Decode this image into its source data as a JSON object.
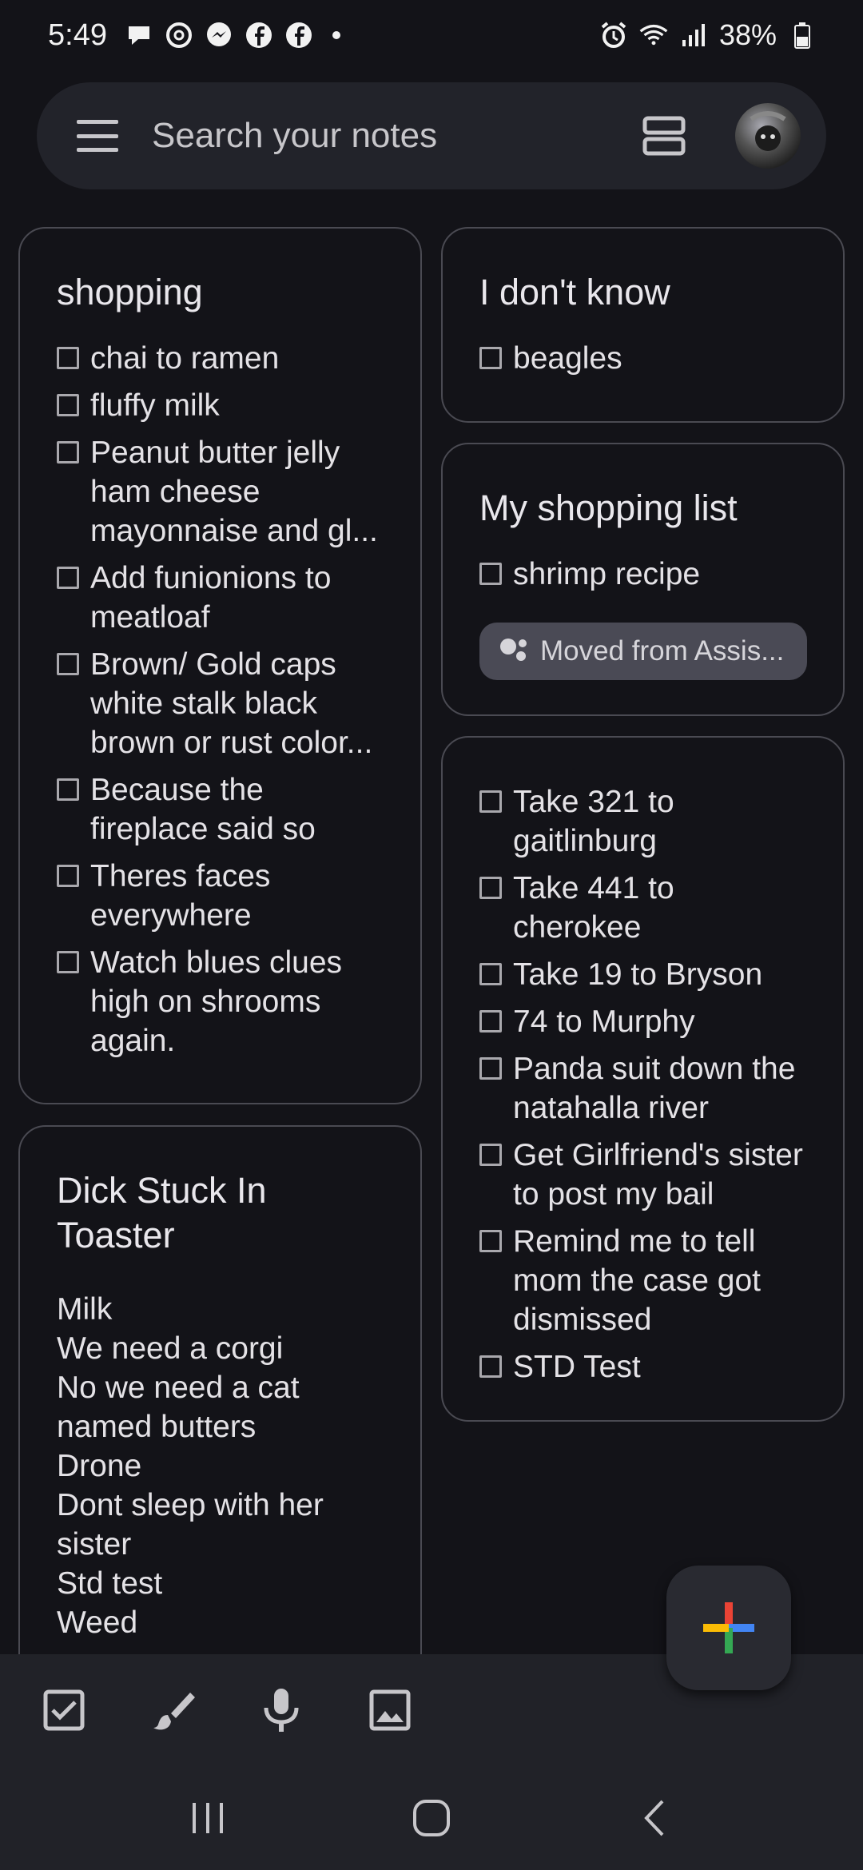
{
  "status_bar": {
    "time": "5:49",
    "notification_icons": [
      "chat-bubble-icon",
      "threads-icon",
      "messenger-icon",
      "facebook-icon",
      "facebook-icon"
    ],
    "battery": "38%"
  },
  "search": {
    "placeholder": "Search your notes"
  },
  "notes": {
    "shopping": {
      "title": "shopping",
      "items": [
        "chai to ramen",
        "fluffy milk",
        "Peanut butter jelly ham cheese mayonnaise and gl...",
        "Add funionions to meatloaf",
        "Brown/ Gold caps white stalk black brown or rust color...",
        "Because the fireplace said so",
        "Theres faces everywhere",
        "Watch blues clues high on shrooms again."
      ]
    },
    "i_dont_know": {
      "title": "I don't know",
      "items": [
        "beagles"
      ]
    },
    "my_shopping_list": {
      "title": "My shopping list",
      "items": [
        "shrimp recipe"
      ],
      "chip": "Moved from Assis..."
    },
    "trip": {
      "items": [
        "Take 321 to gaitlinburg",
        "Take 441 to cherokee",
        "Take 19 to Bryson",
        "74 to Murphy",
        "Panda suit down the natahalla river",
        "Get Girlfriend's sister to post my bail",
        "Remind me to tell mom the case got dismissed",
        "STD Test"
      ]
    },
    "toaster": {
      "title": "Dick Stuck In Toaster",
      "lines": [
        "Milk",
        "We need a corgi",
        "No we need a cat named butters",
        "Drone",
        "Dont sleep with her sister",
        "Std test",
        "Weed"
      ]
    }
  },
  "toolbar": {
    "icons": [
      "checkbox-icon",
      "brush-icon",
      "microphone-icon",
      "image-icon"
    ]
  },
  "colors": {
    "background": "#131318",
    "card_border": "#4a4a52",
    "fab_plus": [
      "#4285F4",
      "#EA4335",
      "#FBBC05",
      "#34A853"
    ]
  }
}
